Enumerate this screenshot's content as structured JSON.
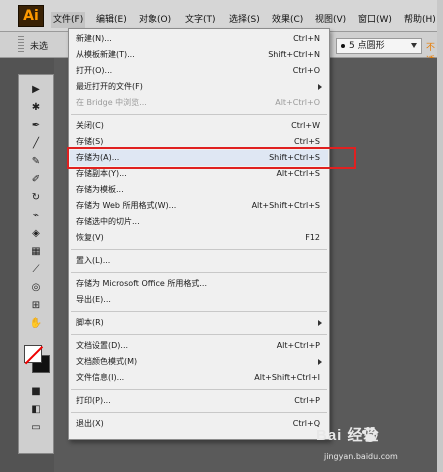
{
  "app": {
    "logo_text": "Ai"
  },
  "menubar": {
    "items": [
      "文件(F)",
      "编辑(E)",
      "对象(O)",
      "文字(T)",
      "选择(S)",
      "效果(C)",
      "视图(V)",
      "窗口(W)",
      "帮助(H)"
    ],
    "active_index": 0
  },
  "controlbar": {
    "selection_label": "未选",
    "brush_select": "5 点圆形",
    "style_label": "不透"
  },
  "file_menu": [
    {
      "label": "新建(N)...",
      "shortcut": "Ctrl+N"
    },
    {
      "label": "从模板新建(T)...",
      "shortcut": "Shift+Ctrl+N"
    },
    {
      "label": "打开(O)...",
      "shortcut": "Ctrl+O"
    },
    {
      "label": "最近打开的文件(F)",
      "shortcut": "",
      "submenu": true
    },
    {
      "label": "在 Bridge 中浏览...",
      "shortcut": "Alt+Ctrl+O",
      "disabled": true
    },
    {
      "separator": true
    },
    {
      "label": "关闭(C)",
      "shortcut": "Ctrl+W"
    },
    {
      "label": "存储(S)",
      "shortcut": "Ctrl+S"
    },
    {
      "label": "存储为(A)...",
      "shortcut": "Shift+Ctrl+S",
      "highlight": true
    },
    {
      "label": "存储副本(Y)...",
      "shortcut": "Alt+Ctrl+S"
    },
    {
      "label": "存储为模板...",
      "shortcut": ""
    },
    {
      "label": "存储为 Web 所用格式(W)...",
      "shortcut": "Alt+Shift+Ctrl+S"
    },
    {
      "label": "存储选中的切片...",
      "shortcut": ""
    },
    {
      "label": "恢复(V)",
      "shortcut": "F12"
    },
    {
      "separator": true
    },
    {
      "label": "置入(L)...",
      "shortcut": ""
    },
    {
      "separator": true
    },
    {
      "label": "存储为 Microsoft Office 所用格式...",
      "shortcut": ""
    },
    {
      "label": "导出(E)...",
      "shortcut": ""
    },
    {
      "separator": true
    },
    {
      "label": "脚本(R)",
      "shortcut": "",
      "submenu": true
    },
    {
      "separator": true
    },
    {
      "label": "文档设置(D)...",
      "shortcut": "Alt+Ctrl+P"
    },
    {
      "label": "文档颜色模式(M)",
      "shortcut": "",
      "submenu": true
    },
    {
      "label": "文件信息(I)...",
      "shortcut": "Alt+Shift+Ctrl+I"
    },
    {
      "separator": true
    },
    {
      "label": "打印(P)...",
      "shortcut": "Ctrl+P"
    },
    {
      "separator": true
    },
    {
      "label": "退出(X)",
      "shortcut": "Ctrl+Q"
    }
  ],
  "watermark": {
    "main": "Bai  经验",
    "sub": "jingyan.baidu.com"
  },
  "colors": {
    "highlight_box": "#e02020",
    "logo_fg": "#ff9a00",
    "logo_bg": "#3a2205"
  }
}
